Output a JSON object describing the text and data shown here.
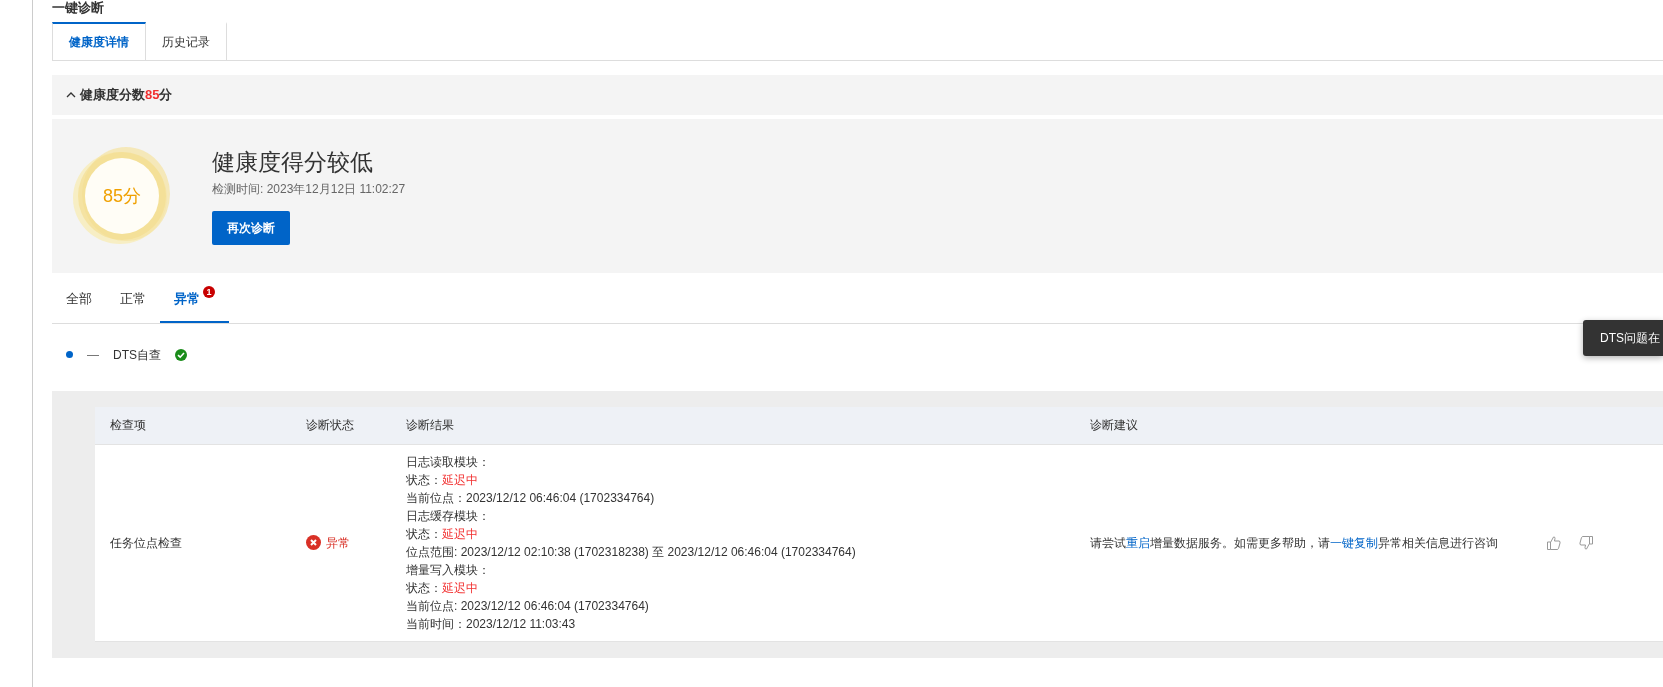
{
  "page_title": "一键诊断",
  "tabs": [
    {
      "label": "健康度详情",
      "selected": true
    },
    {
      "label": "历史记录",
      "selected": false
    }
  ],
  "health": {
    "expanded": true,
    "heading": "健康度分数",
    "score_inline": "85",
    "unit_inline": "分",
    "score": "85分",
    "verdict": "健康度得分较低",
    "check_time": "检测时间: 2023年12月12日 11:02:27",
    "rediagnose_button": "再次诊断"
  },
  "filter_tabs": [
    {
      "label": "全部",
      "selected": false
    },
    {
      "label": "正常",
      "selected": false
    },
    {
      "label": "异常",
      "selected": true,
      "badge": "1"
    }
  ],
  "group": {
    "dash": "—",
    "name": "DTS自查",
    "passed": true
  },
  "tooltip": "DTS问题在",
  "table": {
    "columns": [
      "检查项",
      "诊断状态",
      "诊断结果",
      "诊断建议"
    ],
    "rows": [
      {
        "item": "任务位点检查",
        "status": "异常",
        "abnormal": true,
        "result_lines": [
          {
            "text": "日志读取模块："
          },
          {
            "text": "状态：",
            "alert": "延迟中"
          },
          {
            "text": "当前位点：2023/12/12 06:46:04 (1702334764)"
          },
          {
            "text": "日志缓存模块："
          },
          {
            "text": "状态：",
            "alert": "延迟中"
          },
          {
            "text": "位点范围: 2023/12/12 02:10:38 (1702318238) 至 2023/12/12 06:46:04 (1702334764)"
          },
          {
            "text": "增量写入模块："
          },
          {
            "text": "状态：",
            "alert": "延迟中"
          },
          {
            "text": "当前位点: 2023/12/12 06:46:04 (1702334764)"
          },
          {
            "text": "当前时间：2023/12/12 11:03:43"
          }
        ],
        "advice": [
          {
            "text": "请尝试",
            "link": false
          },
          {
            "text": "重启",
            "link": true
          },
          {
            "text": "增量数据服务。如需更多帮助，请",
            "link": false
          },
          {
            "text": "一键复制",
            "link": true
          },
          {
            "text": "异常相关信息进行咨询",
            "link": false
          }
        ]
      }
    ]
  }
}
